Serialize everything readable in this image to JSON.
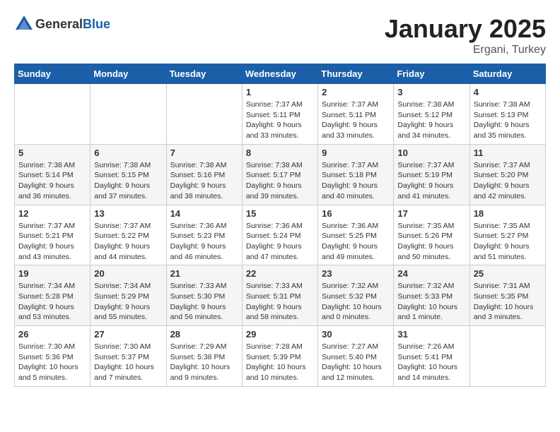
{
  "logo": {
    "text_general": "General",
    "text_blue": "Blue"
  },
  "header": {
    "title": "January 2025",
    "subtitle": "Ergani, Turkey"
  },
  "days_of_week": [
    "Sunday",
    "Monday",
    "Tuesday",
    "Wednesday",
    "Thursday",
    "Friday",
    "Saturday"
  ],
  "weeks": [
    [
      {
        "day": "",
        "info": ""
      },
      {
        "day": "",
        "info": ""
      },
      {
        "day": "",
        "info": ""
      },
      {
        "day": "1",
        "info": "Sunrise: 7:37 AM\nSunset: 5:11 PM\nDaylight: 9 hours and 33 minutes."
      },
      {
        "day": "2",
        "info": "Sunrise: 7:37 AM\nSunset: 5:11 PM\nDaylight: 9 hours and 33 minutes."
      },
      {
        "day": "3",
        "info": "Sunrise: 7:38 AM\nSunset: 5:12 PM\nDaylight: 9 hours and 34 minutes."
      },
      {
        "day": "4",
        "info": "Sunrise: 7:38 AM\nSunset: 5:13 PM\nDaylight: 9 hours and 35 minutes."
      }
    ],
    [
      {
        "day": "5",
        "info": "Sunrise: 7:38 AM\nSunset: 5:14 PM\nDaylight: 9 hours and 36 minutes."
      },
      {
        "day": "6",
        "info": "Sunrise: 7:38 AM\nSunset: 5:15 PM\nDaylight: 9 hours and 37 minutes."
      },
      {
        "day": "7",
        "info": "Sunrise: 7:38 AM\nSunset: 5:16 PM\nDaylight: 9 hours and 38 minutes."
      },
      {
        "day": "8",
        "info": "Sunrise: 7:38 AM\nSunset: 5:17 PM\nDaylight: 9 hours and 39 minutes."
      },
      {
        "day": "9",
        "info": "Sunrise: 7:37 AM\nSunset: 5:18 PM\nDaylight: 9 hours and 40 minutes."
      },
      {
        "day": "10",
        "info": "Sunrise: 7:37 AM\nSunset: 5:19 PM\nDaylight: 9 hours and 41 minutes."
      },
      {
        "day": "11",
        "info": "Sunrise: 7:37 AM\nSunset: 5:20 PM\nDaylight: 9 hours and 42 minutes."
      }
    ],
    [
      {
        "day": "12",
        "info": "Sunrise: 7:37 AM\nSunset: 5:21 PM\nDaylight: 9 hours and 43 minutes."
      },
      {
        "day": "13",
        "info": "Sunrise: 7:37 AM\nSunset: 5:22 PM\nDaylight: 9 hours and 44 minutes."
      },
      {
        "day": "14",
        "info": "Sunrise: 7:36 AM\nSunset: 5:23 PM\nDaylight: 9 hours and 46 minutes."
      },
      {
        "day": "15",
        "info": "Sunrise: 7:36 AM\nSunset: 5:24 PM\nDaylight: 9 hours and 47 minutes."
      },
      {
        "day": "16",
        "info": "Sunrise: 7:36 AM\nSunset: 5:25 PM\nDaylight: 9 hours and 49 minutes."
      },
      {
        "day": "17",
        "info": "Sunrise: 7:35 AM\nSunset: 5:26 PM\nDaylight: 9 hours and 50 minutes."
      },
      {
        "day": "18",
        "info": "Sunrise: 7:35 AM\nSunset: 5:27 PM\nDaylight: 9 hours and 51 minutes."
      }
    ],
    [
      {
        "day": "19",
        "info": "Sunrise: 7:34 AM\nSunset: 5:28 PM\nDaylight: 9 hours and 53 minutes."
      },
      {
        "day": "20",
        "info": "Sunrise: 7:34 AM\nSunset: 5:29 PM\nDaylight: 9 hours and 55 minutes."
      },
      {
        "day": "21",
        "info": "Sunrise: 7:33 AM\nSunset: 5:30 PM\nDaylight: 9 hours and 56 minutes."
      },
      {
        "day": "22",
        "info": "Sunrise: 7:33 AM\nSunset: 5:31 PM\nDaylight: 9 hours and 58 minutes."
      },
      {
        "day": "23",
        "info": "Sunrise: 7:32 AM\nSunset: 5:32 PM\nDaylight: 10 hours and 0 minutes."
      },
      {
        "day": "24",
        "info": "Sunrise: 7:32 AM\nSunset: 5:33 PM\nDaylight: 10 hours and 1 minute."
      },
      {
        "day": "25",
        "info": "Sunrise: 7:31 AM\nSunset: 5:35 PM\nDaylight: 10 hours and 3 minutes."
      }
    ],
    [
      {
        "day": "26",
        "info": "Sunrise: 7:30 AM\nSunset: 5:36 PM\nDaylight: 10 hours and 5 minutes."
      },
      {
        "day": "27",
        "info": "Sunrise: 7:30 AM\nSunset: 5:37 PM\nDaylight: 10 hours and 7 minutes."
      },
      {
        "day": "28",
        "info": "Sunrise: 7:29 AM\nSunset: 5:38 PM\nDaylight: 10 hours and 9 minutes."
      },
      {
        "day": "29",
        "info": "Sunrise: 7:28 AM\nSunset: 5:39 PM\nDaylight: 10 hours and 10 minutes."
      },
      {
        "day": "30",
        "info": "Sunrise: 7:27 AM\nSunset: 5:40 PM\nDaylight: 10 hours and 12 minutes."
      },
      {
        "day": "31",
        "info": "Sunrise: 7:26 AM\nSunset: 5:41 PM\nDaylight: 10 hours and 14 minutes."
      },
      {
        "day": "",
        "info": ""
      }
    ]
  ]
}
